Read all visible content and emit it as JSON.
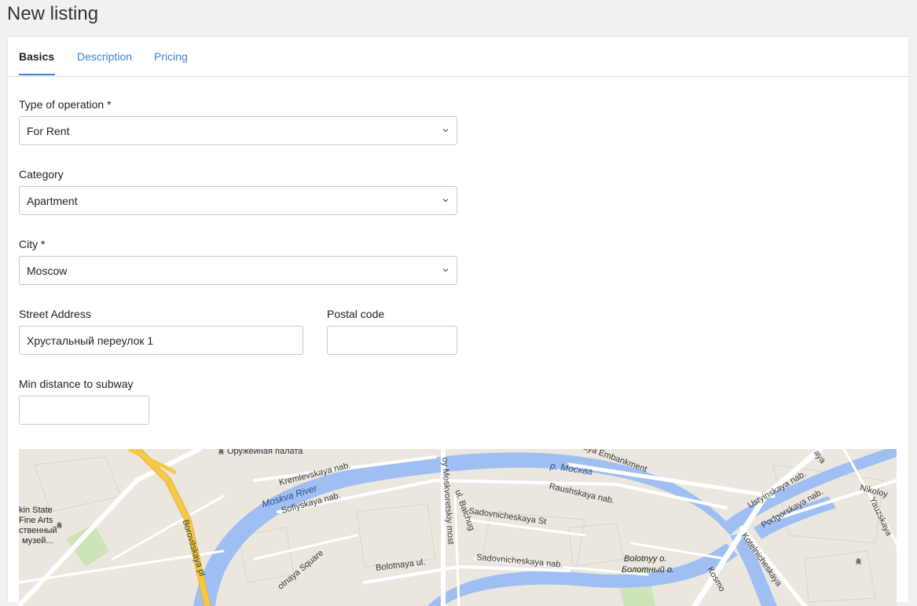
{
  "page": {
    "title": "New listing"
  },
  "tabs": [
    {
      "label": "Basics",
      "active": true
    },
    {
      "label": "Description",
      "active": false
    },
    {
      "label": "Pricing",
      "active": false
    }
  ],
  "form": {
    "operation": {
      "label": "Type of operation *",
      "value": "For Rent"
    },
    "category": {
      "label": "Category",
      "value": "Apartment"
    },
    "city": {
      "label": "City *",
      "value": "Moscow"
    },
    "street": {
      "label": "Street Address",
      "value": "Хрустальный переулок 1"
    },
    "postal": {
      "label": "Postal code",
      "value": ""
    },
    "subway": {
      "label": "Min distance to subway",
      "value": ""
    }
  },
  "map": {
    "labels": {
      "armoury": "Оружейная палата",
      "kremlevskaya": "Kremlevskaya nab.",
      "moskva_river": "Moskva River",
      "sofiyskaya": "Sofiyskaya nab.",
      "borovitskaya": "Borovitskaya pl",
      "museum_1": "kin State",
      "museum_2": "Fine Arts",
      "museum_3": "ственный",
      "museum_4": "музей...",
      "bolotnaya_sq": "otnaya Square",
      "bolotnaya_ul": "Bolotnaya ul.",
      "moskvoretsky": "oy Moskvoretskiy most",
      "balchug": "ul. Balchug",
      "sadovnicheskaya_st": "Sadovnicheskaya St",
      "sadovnicheskaya_nab": "Sadovnicheskaya nab.",
      "raushskaya": "Raushskaya nab.",
      "river_ru": "р. Москва",
      "embankment": "aya Embankment",
      "bolotnyy_en": "Bolotnyy o.",
      "bolotnyy_ru": "Болотный о.",
      "kosmo": "Kosmo",
      "ustyinskaya": "Ustyinskaya nab.",
      "podgorskaya": "Podgorskaya nab.",
      "kotelnicheskaya": "Kotelnicheskaya",
      "nikoloy": "Nikoloy",
      "yauzskaya": "Yauzskaya",
      "yauz_top": "aya"
    },
    "colors": {
      "water": "#9fbff3",
      "land": "#ebe7df",
      "road": "#ffffff",
      "major_road": "#f5c848",
      "park": "#cde3b8"
    }
  }
}
